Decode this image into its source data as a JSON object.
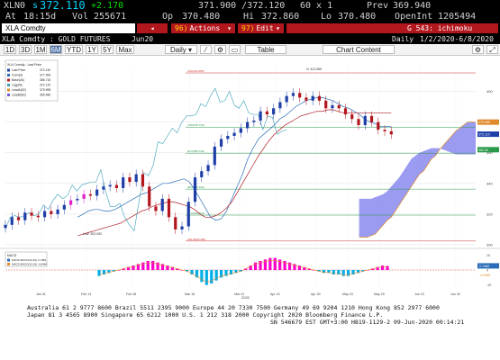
{
  "quote": {
    "ticker": "XLN0",
    "last_prefix": "s",
    "last": "372.110",
    "change": "+2.170",
    "bid_ask": "371.900 /372.120",
    "size": "60 x 1",
    "prev_label": "Prev",
    "prev": "369.940",
    "at_label": "At",
    "time": "18:15d",
    "vol_label": "Vol",
    "volume": "255671",
    "open_label": "Op",
    "open": "370.480",
    "hi_label": "Hi",
    "high": "372.860",
    "lo_label": "Lo",
    "low": "370.480",
    "oi_label": "OpenInt",
    "open_interest": "1205494"
  },
  "toolbar": {
    "security": "XLA Comdty",
    "search_arrow": "◂",
    "actions_num": "96)",
    "actions_label": "Actions",
    "edit_num": "97)",
    "edit_label": "Edit",
    "chart_title": "G 543: ichimoku"
  },
  "security_row": {
    "name": "XLA Comdty : GOLD FUTURES",
    "contract": "Jun20",
    "period_label": "Daily",
    "date_range": "1/2/2020-6/8/2020"
  },
  "controls": {
    "ranges": [
      "1D",
      "3D",
      "1M",
      "6M",
      "YTD",
      "1Y",
      "5Y",
      "Max"
    ],
    "active_range": "6M",
    "frequency": "Daily",
    "table_label": "Table",
    "chart_content_label": "Chart Content"
  },
  "legend": {
    "title": "XLA Comdty - Last Price",
    "items": [
      {
        "name": "Last Price",
        "value": "372.110",
        "color": "#1f3fa8"
      },
      {
        "name": "Conv(9)",
        "value": "377.300",
        "color": "#2a6cb8"
      },
      {
        "name": "Base(26)",
        "value": "385.710",
        "color": "#b0202a"
      },
      {
        "name": "Lag(26)",
        "value": "372.110",
        "color": "#39a0b8"
      },
      {
        "name": "LeadA(52)",
        "value": "379.995",
        "color": "#e08a2a"
      },
      {
        "name": "LeadB(52)",
        "value": "359.480",
        "color": "#6a5acd"
      }
    ]
  },
  "axis": {
    "price_ticks": [
      "400",
      "380",
      "360",
      "340",
      "320",
      "300"
    ],
    "price_current": "372.110",
    "price_alt": "379.995",
    "price_alt2": "362.00",
    "x_labels": [
      "Jan 31",
      "Feb 14",
      "Feb 28",
      "Mar 16",
      "Mar 31",
      "Apr 15",
      "Apr 30",
      "May 15",
      "May 29",
      "Jun 15",
      "Jun 30"
    ],
    "year_label": "2020",
    "macd_ticks": [
      "10",
      "0",
      "-10"
    ],
    "macd_current": "2.7489",
    "macd_signal": "-0.0466"
  },
  "fib_labels": [
    "0.00(412.050)",
    "0.00(376.723)",
    "50.0(359.730)",
    "38.2(336.300)",
    "61.8(319.350)",
    "100.0(302.450)"
  ],
  "annotations": {
    "high": "H: 412.965",
    "low": "Low: 302.050"
  },
  "macd_legend": {
    "title": "MACD",
    "items": [
      {
        "name": "MACD MACD(12,26) 2.7489",
        "color": "#2a6cb8"
      },
      {
        "name": "MACD MACD(12,26) -0.0466",
        "color": "#e08a2a"
      }
    ]
  },
  "chart_data": {
    "type": "line",
    "title": "G 543: ichimoku",
    "x_range": [
      "2020-01-02",
      "2020-06-30"
    ],
    "ylim": [
      300,
      415
    ],
    "series": [
      {
        "name": "Last Price",
        "values": [
          313,
          318,
          316,
          321,
          319,
          318,
          322,
          320,
          323,
          326,
          329,
          330,
          333,
          332,
          336,
          338,
          339,
          337,
          344,
          341,
          346,
          338,
          325,
          322,
          330,
          318,
          310,
          312,
          328,
          344,
          348,
          352,
          364,
          369,
          371,
          373,
          376,
          380,
          381,
          387,
          385,
          389,
          393,
          397,
          399,
          396,
          394,
          397,
          394,
          389,
          391,
          389,
          385,
          382,
          378,
          384,
          380,
          375,
          374,
          372
        ]
      },
      {
        "name": "Conv(9)",
        "values": [
          318,
          320,
          322,
          323,
          323,
          322,
          322,
          323,
          325,
          327,
          329,
          331,
          333,
          334,
          336,
          338,
          340,
          340,
          341,
          342,
          343,
          341,
          336,
          330,
          324,
          318,
          316,
          317,
          322,
          330,
          338,
          346,
          356,
          363,
          369,
          372,
          375,
          378,
          382,
          384,
          387,
          390,
          392,
          394,
          395,
          396,
          396,
          395,
          394,
          392,
          390,
          389,
          387,
          385,
          382,
          380,
          379,
          377,
          377,
          377
        ]
      },
      {
        "name": "Base(26)",
        "values": [
          306,
          307,
          308,
          309,
          310,
          311,
          312,
          313,
          314,
          316,
          318,
          320,
          322,
          323,
          325,
          326,
          327,
          328,
          328,
          327,
          326,
          325,
          323,
          320,
          318,
          318,
          319,
          321,
          324,
          328,
          334,
          340,
          346,
          352,
          358,
          363,
          368,
          372,
          375,
          378,
          380,
          382,
          384,
          385,
          386,
          387,
          387,
          388,
          388,
          387,
          386,
          386,
          386,
          386,
          386,
          386,
          386,
          386,
          386,
          386
        ]
      },
      {
        "name": "LeadA(52)",
        "values": [
          305,
          305,
          305,
          306,
          307,
          310,
          313,
          316,
          318,
          322,
          326,
          330,
          334,
          338,
          342,
          346,
          348,
          352,
          356,
          358,
          362,
          365,
          368,
          371,
          374,
          376,
          378,
          380,
          380,
          380
        ]
      },
      {
        "name": "LeadB(52)",
        "values": [
          330,
          330,
          330,
          330,
          331,
          332,
          333,
          335,
          338,
          341,
          344,
          348,
          352,
          356,
          358,
          360,
          361,
          362,
          363,
          363,
          363,
          362,
          361,
          360,
          359,
          359,
          359,
          359,
          359,
          359
        ]
      }
    ],
    "fib_levels": [
      412.05,
      376.723,
      359.73,
      336.3,
      319.35,
      302.45
    ],
    "macd": {
      "histogram": [
        -4,
        -3,
        -2,
        -1,
        0,
        1,
        2,
        3,
        4,
        5,
        6,
        6,
        5,
        4,
        3,
        2,
        1,
        0,
        -1,
        -3,
        -5,
        -8,
        -10,
        -9,
        -7,
        -5,
        -4,
        -3,
        -2,
        -1,
        1,
        3,
        5,
        6,
        7,
        8,
        8,
        7,
        6,
        5,
        4,
        3,
        2,
        1,
        0,
        -1,
        -2,
        -2,
        -3,
        -3,
        -4,
        -4,
        -3,
        -2,
        -1,
        0,
        1,
        2,
        3,
        2.7
      ],
      "ylim": [
        -12,
        12
      ],
      "highlight_color_positive": "#ff00cc",
      "highlight_color_negative": "#00aee8"
    }
  },
  "colors": {
    "up_candle": "#1f3fa8",
    "down_candle": "#b3171e",
    "highlight_candle": "#e020c8",
    "cloud": "#8a8aee",
    "accent_red": "#b3171e",
    "bbg_amber": "#ffd200"
  },
  "footer": {
    "line1": "Australia 61 2 9777 8600 Brazil 5511 2395 9000 Europe 44 20 7330 7500 Germany 49 69 9204 1210 Hong Kong 852 2977 6000",
    "line2": "Japan 81 3 4565 8900         Singapore 65 6212 1000         U.S. 1 212 318 2000         Copyright 2020 Bloomberg Finance L.P.",
    "line3": "SN 546679 EST  GMT+3:00 H819-1129-2 09-Jun-2020 00:14:21"
  }
}
